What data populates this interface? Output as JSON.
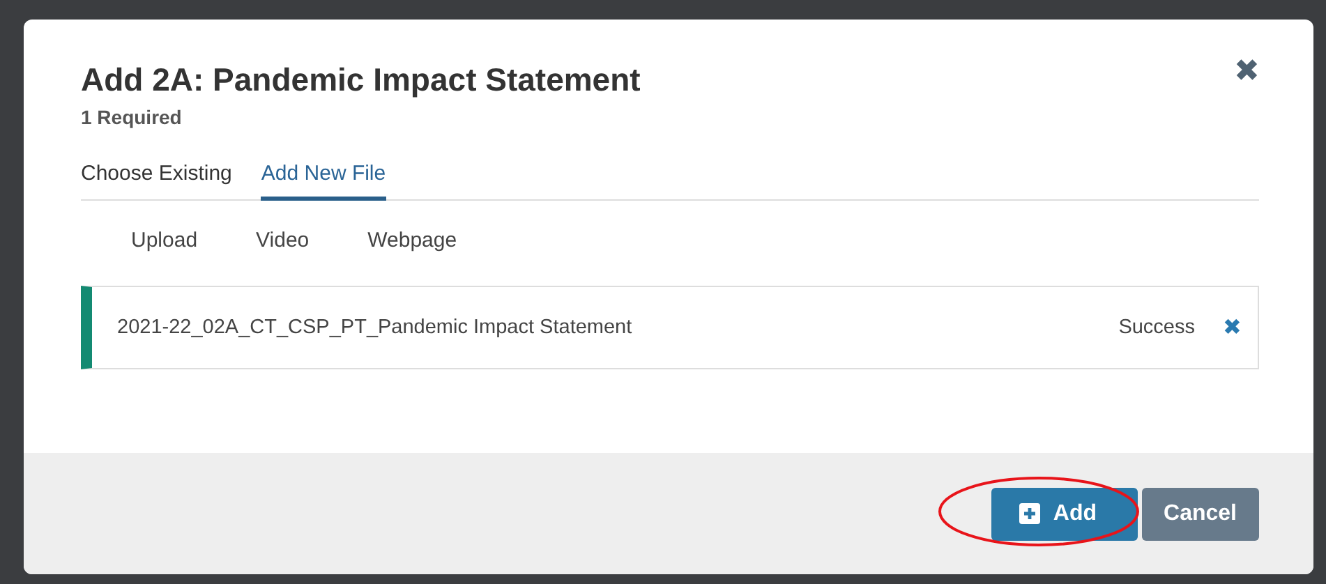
{
  "dialog": {
    "title": "Add 2A: Pandemic Impact Statement",
    "subtitle": "1 Required",
    "close_icon": "✖"
  },
  "tabs": [
    {
      "label": "Choose Existing",
      "selected": false
    },
    {
      "label": "Add New File",
      "selected": true
    }
  ],
  "sources": [
    "Upload",
    "Video",
    "Webpage"
  ],
  "files": [
    {
      "name": "2021-22_02A_CT_CSP_PT_Pandemic Impact Statement",
      "status": "Success",
      "remove_icon": "✖"
    }
  ],
  "buttons": [
    {
      "label": "Add",
      "kind": "primary",
      "highlighted": true
    },
    {
      "label": "Cancel",
      "kind": "secondary",
      "highlighted": false
    }
  ]
}
